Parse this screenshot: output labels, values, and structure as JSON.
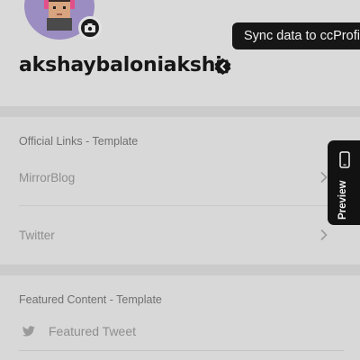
{
  "profile": {
    "username": "akshaybaloniakshi",
    "avatar_icon": "pixel-avatar",
    "camera_icon": "camera-icon",
    "verified_icon": "verified-badge-icon"
  },
  "tooltip": {
    "text": "Sync data to ccProfile"
  },
  "official_links": {
    "title": "Official Links - Template",
    "items": [
      {
        "label": "MirrorBlog",
        "icon": "chevron-right-icon"
      },
      {
        "label": "Twitter",
        "icon": "chevron-right-icon"
      }
    ]
  },
  "featured_content": {
    "title": "Featured Content - Template",
    "items": [
      {
        "label": "Featured Tweet",
        "icon": "twitter-icon"
      }
    ]
  },
  "preview": {
    "label": "Preview",
    "icon": "phone-icon"
  },
  "colors": {
    "overlay_background": "#d9d9d9",
    "username": "#161616",
    "tooltip_background": "#161616",
    "preview_background": "#121212",
    "avatar_background": "#9b8cc1"
  }
}
